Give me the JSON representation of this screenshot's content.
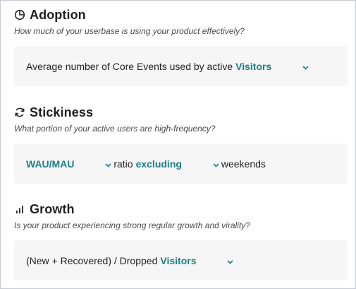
{
  "sections": [
    {
      "title": "Adoption",
      "icon": "pie-chart-icon",
      "description": "How much of your userbase is using your product effectively?",
      "sentence": {
        "prefix": "Average number of Core Events used by active",
        "dropdown": "Visitors"
      }
    },
    {
      "title": "Stickiness",
      "icon": "refresh-icon",
      "description": "What portion of your active users are high-frequency?",
      "sentence": {
        "dropdown1": "WAU/MAU",
        "middle": "ratio",
        "dropdown2": "excluding",
        "suffix": "weekends"
      }
    },
    {
      "title": "Growth",
      "icon": "bar-chart-icon",
      "description": "Is your product experiencing strong regular growth and virality?",
      "sentence": {
        "prefix": "(New + Recovered) / Dropped",
        "dropdown": "Visitors"
      }
    }
  ],
  "colors": {
    "accent": "#1a7f88",
    "card_bg": "#f6f6f6",
    "border": "#c9c9d6"
  }
}
